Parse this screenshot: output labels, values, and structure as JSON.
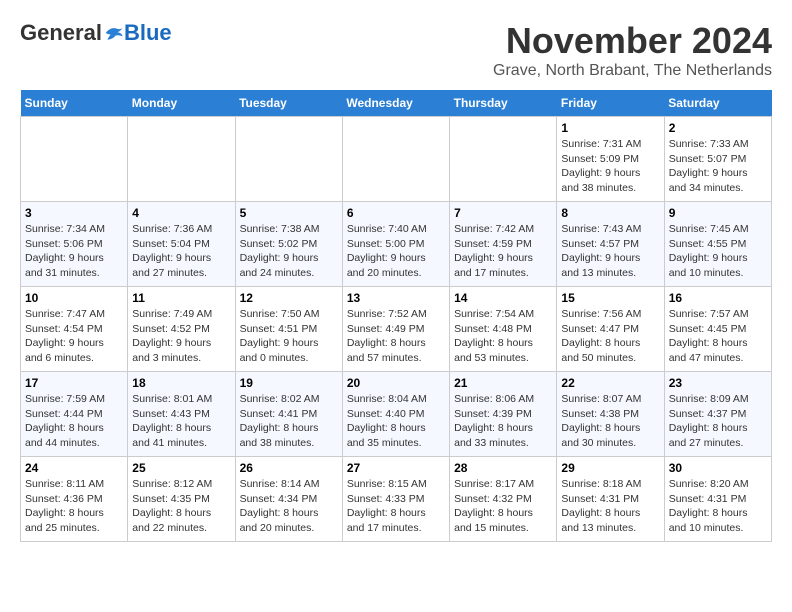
{
  "logo": {
    "general": "General",
    "blue": "Blue"
  },
  "title": "November 2024",
  "location": "Grave, North Brabant, The Netherlands",
  "header_days": [
    "Sunday",
    "Monday",
    "Tuesday",
    "Wednesday",
    "Thursday",
    "Friday",
    "Saturday"
  ],
  "weeks": [
    [
      {
        "day": "",
        "info": ""
      },
      {
        "day": "",
        "info": ""
      },
      {
        "day": "",
        "info": ""
      },
      {
        "day": "",
        "info": ""
      },
      {
        "day": "",
        "info": ""
      },
      {
        "day": "1",
        "info": "Sunrise: 7:31 AM\nSunset: 5:09 PM\nDaylight: 9 hours and 38 minutes."
      },
      {
        "day": "2",
        "info": "Sunrise: 7:33 AM\nSunset: 5:07 PM\nDaylight: 9 hours and 34 minutes."
      }
    ],
    [
      {
        "day": "3",
        "info": "Sunrise: 7:34 AM\nSunset: 5:06 PM\nDaylight: 9 hours and 31 minutes."
      },
      {
        "day": "4",
        "info": "Sunrise: 7:36 AM\nSunset: 5:04 PM\nDaylight: 9 hours and 27 minutes."
      },
      {
        "day": "5",
        "info": "Sunrise: 7:38 AM\nSunset: 5:02 PM\nDaylight: 9 hours and 24 minutes."
      },
      {
        "day": "6",
        "info": "Sunrise: 7:40 AM\nSunset: 5:00 PM\nDaylight: 9 hours and 20 minutes."
      },
      {
        "day": "7",
        "info": "Sunrise: 7:42 AM\nSunset: 4:59 PM\nDaylight: 9 hours and 17 minutes."
      },
      {
        "day": "8",
        "info": "Sunrise: 7:43 AM\nSunset: 4:57 PM\nDaylight: 9 hours and 13 minutes."
      },
      {
        "day": "9",
        "info": "Sunrise: 7:45 AM\nSunset: 4:55 PM\nDaylight: 9 hours and 10 minutes."
      }
    ],
    [
      {
        "day": "10",
        "info": "Sunrise: 7:47 AM\nSunset: 4:54 PM\nDaylight: 9 hours and 6 minutes."
      },
      {
        "day": "11",
        "info": "Sunrise: 7:49 AM\nSunset: 4:52 PM\nDaylight: 9 hours and 3 minutes."
      },
      {
        "day": "12",
        "info": "Sunrise: 7:50 AM\nSunset: 4:51 PM\nDaylight: 9 hours and 0 minutes."
      },
      {
        "day": "13",
        "info": "Sunrise: 7:52 AM\nSunset: 4:49 PM\nDaylight: 8 hours and 57 minutes."
      },
      {
        "day": "14",
        "info": "Sunrise: 7:54 AM\nSunset: 4:48 PM\nDaylight: 8 hours and 53 minutes."
      },
      {
        "day": "15",
        "info": "Sunrise: 7:56 AM\nSunset: 4:47 PM\nDaylight: 8 hours and 50 minutes."
      },
      {
        "day": "16",
        "info": "Sunrise: 7:57 AM\nSunset: 4:45 PM\nDaylight: 8 hours and 47 minutes."
      }
    ],
    [
      {
        "day": "17",
        "info": "Sunrise: 7:59 AM\nSunset: 4:44 PM\nDaylight: 8 hours and 44 minutes."
      },
      {
        "day": "18",
        "info": "Sunrise: 8:01 AM\nSunset: 4:43 PM\nDaylight: 8 hours and 41 minutes."
      },
      {
        "day": "19",
        "info": "Sunrise: 8:02 AM\nSunset: 4:41 PM\nDaylight: 8 hours and 38 minutes."
      },
      {
        "day": "20",
        "info": "Sunrise: 8:04 AM\nSunset: 4:40 PM\nDaylight: 8 hours and 35 minutes."
      },
      {
        "day": "21",
        "info": "Sunrise: 8:06 AM\nSunset: 4:39 PM\nDaylight: 8 hours and 33 minutes."
      },
      {
        "day": "22",
        "info": "Sunrise: 8:07 AM\nSunset: 4:38 PM\nDaylight: 8 hours and 30 minutes."
      },
      {
        "day": "23",
        "info": "Sunrise: 8:09 AM\nSunset: 4:37 PM\nDaylight: 8 hours and 27 minutes."
      }
    ],
    [
      {
        "day": "24",
        "info": "Sunrise: 8:11 AM\nSunset: 4:36 PM\nDaylight: 8 hours and 25 minutes."
      },
      {
        "day": "25",
        "info": "Sunrise: 8:12 AM\nSunset: 4:35 PM\nDaylight: 8 hours and 22 minutes."
      },
      {
        "day": "26",
        "info": "Sunrise: 8:14 AM\nSunset: 4:34 PM\nDaylight: 8 hours and 20 minutes."
      },
      {
        "day": "27",
        "info": "Sunrise: 8:15 AM\nSunset: 4:33 PM\nDaylight: 8 hours and 17 minutes."
      },
      {
        "day": "28",
        "info": "Sunrise: 8:17 AM\nSunset: 4:32 PM\nDaylight: 8 hours and 15 minutes."
      },
      {
        "day": "29",
        "info": "Sunrise: 8:18 AM\nSunset: 4:31 PM\nDaylight: 8 hours and 13 minutes."
      },
      {
        "day": "30",
        "info": "Sunrise: 8:20 AM\nSunset: 4:31 PM\nDaylight: 8 hours and 10 minutes."
      }
    ]
  ]
}
